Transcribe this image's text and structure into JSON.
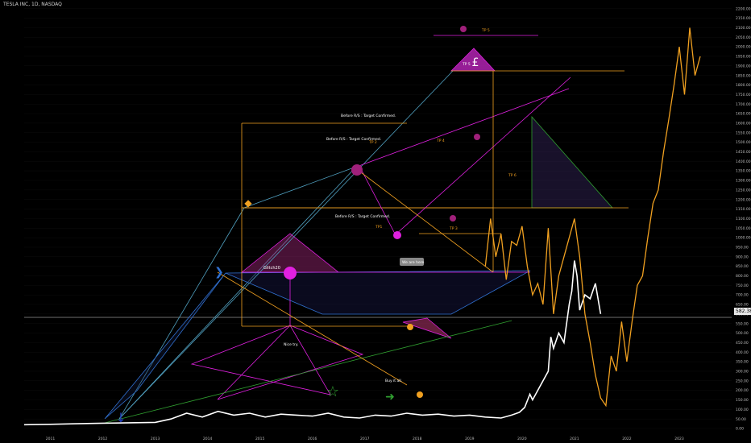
{
  "header": {
    "ticker": "TESLA INC, 1D, NASDAQ"
  },
  "price_badge": "582.38",
  "colors": {
    "background": "#000000",
    "price_line": "#ffffff",
    "projection": "#f0a020",
    "magenta": "#e020e0",
    "blue": "#3070d0",
    "cyan": "#50a0c0",
    "green": "#30a030",
    "orange": "#f0a020"
  },
  "annotations": {
    "before_rs_top": "Before R/S : Target Confirmed.",
    "before_rs_mid": "Before R/S : Target Confirmed.",
    "before_rs_low": "Before R/S : Target Confirmed.",
    "glitch": "Glitch20",
    "nice_try": "Nice try.",
    "we_are_here": "We are here.",
    "buy_it_all": "Buy it all.",
    "tp1": "TP1",
    "tp2": "TP 2",
    "tp3": "TP 3",
    "tp4": "TP 4",
    "tp5": "TP 5",
    "tp5b": "TP 5",
    "tp6": "TP 6"
  },
  "chart_data": {
    "type": "line",
    "title": "TESLA INC, 1D, NASDAQ",
    "xlabel": "",
    "ylabel": "",
    "x_ticks": [
      "2011",
      "2012",
      "2013",
      "2014",
      "2015",
      "2016",
      "2017",
      "2018",
      "2019",
      "2020",
      "2021",
      "2022",
      "2023"
    ],
    "y_ticks": [
      0,
      50,
      100,
      150,
      200,
      250,
      300,
      350,
      400,
      450,
      500,
      550,
      600,
      650,
      700,
      750,
      800,
      850,
      900,
      950,
      1000,
      1050,
      1100,
      1150,
      1200,
      1250,
      1300,
      1350,
      1400,
      1450,
      1500,
      1550,
      1600,
      1650,
      1700,
      1750,
      1800,
      1850,
      1900,
      1950,
      2000,
      2050,
      2100,
      2150,
      2200
    ],
    "ylim": [
      0,
      2220
    ],
    "xlim": [
      2010.5,
      2024.0
    ],
    "last_price": 582.38,
    "series": [
      {
        "name": "",
        "color": "#ffffff",
        "x": [
          2010.5,
          2011.0,
          2011.5,
          2012.0,
          2012.5,
          2013.0,
          2013.3,
          2013.6,
          2013.9,
          2014.2,
          2014.5,
          2014.8,
          2015.1,
          2015.4,
          2015.7,
          2016.0,
          2016.3,
          2016.6,
          2016.9,
          2017.2,
          2017.5,
          2017.8,
          2018.1,
          2018.4,
          2018.7,
          2019.0,
          2019.3,
          2019.6,
          2019.8,
          2019.95,
          2020.05,
          2020.15,
          2020.2,
          2020.3,
          2020.4,
          2020.5,
          2020.55,
          2020.6,
          2020.7,
          2020.8,
          2020.9,
          2020.95,
          2021.0,
          2021.05,
          2021.1,
          2021.2,
          2021.3,
          2021.4,
          2021.5
        ],
        "values": [
          20,
          22,
          25,
          28,
          30,
          32,
          50,
          80,
          60,
          90,
          70,
          80,
          60,
          75,
          70,
          65,
          80,
          60,
          55,
          70,
          65,
          80,
          70,
          75,
          65,
          70,
          60,
          55,
          70,
          85,
          110,
          180,
          150,
          200,
          250,
          300,
          480,
          420,
          500,
          450,
          650,
          720,
          880,
          800,
          620,
          700,
          680,
          760,
          600
        ]
      },
      {
        "name": "",
        "color": "#f0a020",
        "x": [
          2019.3,
          2019.4,
          2019.5,
          2019.6,
          2019.7,
          2019.8,
          2019.9,
          2020.0,
          2020.1,
          2020.2,
          2020.3,
          2020.4,
          2020.5,
          2020.6,
          2020.7,
          2020.8,
          2020.9,
          2021.0,
          2021.1,
          2021.2,
          2021.3,
          2021.4,
          2021.5,
          2021.6,
          2021.7,
          2021.8,
          2021.9,
          2022.0,
          2022.1,
          2022.2,
          2022.3,
          2022.4,
          2022.5,
          2022.6,
          2022.7,
          2022.8,
          2022.9,
          2023.0,
          2023.1,
          2023.2,
          2023.3,
          2023.4
        ],
        "values": [
          850,
          1100,
          900,
          1020,
          780,
          980,
          960,
          1060,
          850,
          700,
          760,
          650,
          1050,
          600,
          800,
          900,
          1000,
          1100,
          900,
          600,
          450,
          280,
          160,
          120,
          380,
          300,
          560,
          350,
          560,
          750,
          800,
          1000,
          1180,
          1250,
          1450,
          1620,
          1800,
          2000,
          1750,
          2100,
          1850,
          1950
        ]
      }
    ]
  }
}
